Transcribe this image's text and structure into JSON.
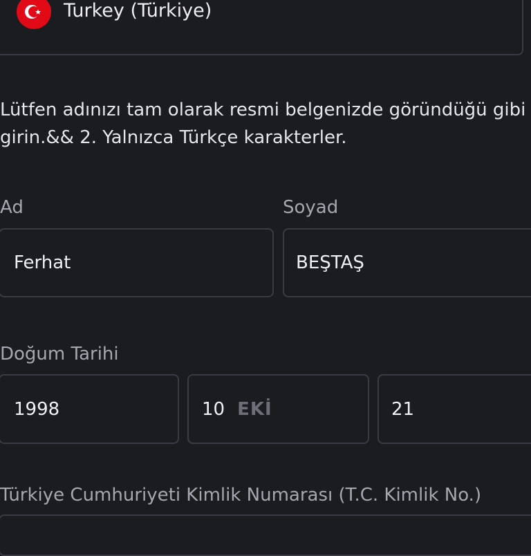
{
  "country_select": {
    "name": "Turkey (Türkiye)",
    "flag_icon": "turkey-flag-icon"
  },
  "instructions": "Lütfen adınızı tam olarak resmi belgenizde göründüğü gibi girin.&& 2. Yalnızca Türkçe karakterler.",
  "first_name": {
    "label": "Ad",
    "value": "Ferhat"
  },
  "last_name": {
    "label": "Soyad",
    "value": "BEŞTAŞ"
  },
  "birth_date": {
    "label": "Doğum Tarihi",
    "year": "1998",
    "month": "10",
    "month_name": "EKİ",
    "day": "21"
  },
  "id_number": {
    "label": "Türkiye Cumhuriyeti Kimlik Numarası (T.C. Kimlik No.)"
  },
  "colors": {
    "background": "#1b1c20",
    "border": "#3a3c43",
    "flag_red": "#e30a17",
    "label": "#a6a8b0"
  }
}
